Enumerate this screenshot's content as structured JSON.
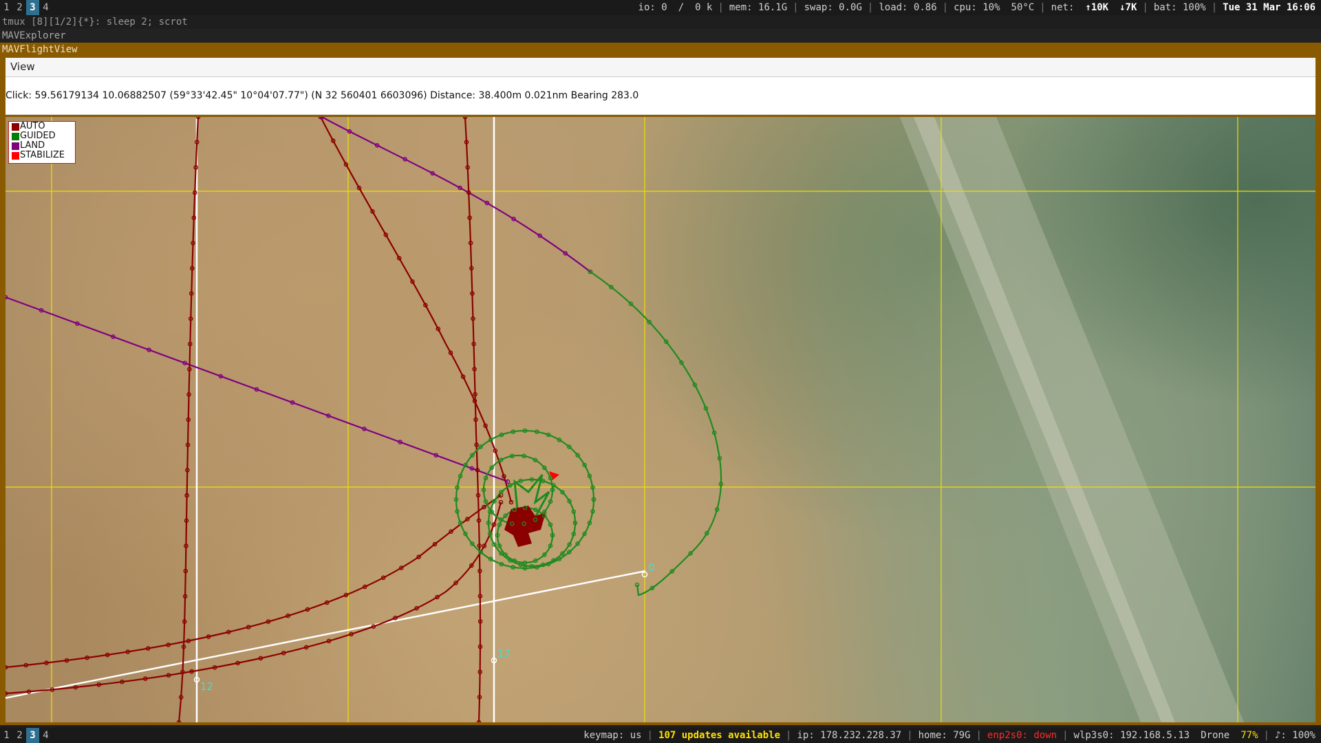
{
  "topbar": {
    "workspaces": [
      "1",
      "2",
      "3",
      "4"
    ],
    "active_workspace": "3",
    "status": {
      "io": "io: 0",
      "io_sep": "/",
      "io_k": "0 k",
      "mem": "mem: 16.1G",
      "swap": "swap: 0.0G",
      "load": "load: 0.86",
      "cpu": "cpu:  10%",
      "temp": "50°C",
      "net": "net:",
      "up": "↑10K",
      "down": "↓7K",
      "bat": "bat: 100%",
      "datetime": "Tue 31 Mar 16:06"
    }
  },
  "tmux": {
    "line": "tmux [8][1/2]{*}:  sleep 2; scrot"
  },
  "windows": {
    "parent_title": "MAVExplorer",
    "title": "MAVFlightView"
  },
  "menubar": {
    "view_label": "View"
  },
  "infobar": {
    "click_text": "Click: 59.56179134 10.06882507 (59°33'42.45\" 10°04'07.77\") (N 32 560401 6603096)  Distance: 38.400m 0.021nm Bearing 283.0"
  },
  "legend": {
    "items": [
      {
        "label": "AUTO",
        "color": "#8b0000"
      },
      {
        "label": "GUIDED",
        "color": "#008000"
      },
      {
        "label": "LAND",
        "color": "#800080"
      },
      {
        "label": "STABILIZE",
        "color": "#ff0000"
      }
    ]
  },
  "map": {
    "waypoint_labels": [
      "0",
      "12",
      "17"
    ],
    "colors": {
      "auto": "#8b0000",
      "guided": "#1e8a1e",
      "land": "#800080",
      "stabilize": "#ff0000",
      "grid": "#f0e000",
      "mission": "#ffffff",
      "label": "#40e0d0"
    }
  },
  "bottombar": {
    "workspaces": [
      "1",
      "2",
      "3",
      "4"
    ],
    "active_workspace": "3",
    "status": {
      "keymap": "keymap: us",
      "updates": "107 updates available",
      "ip": "ip: 178.232.228.37",
      "home": "home: 79G",
      "enp": "enp2s0: down",
      "wlp": "wlp3s0: 192.168.5.13",
      "wifi_name": "Drone",
      "wifi_pct": "77%",
      "volume": "♪: 100%"
    }
  }
}
